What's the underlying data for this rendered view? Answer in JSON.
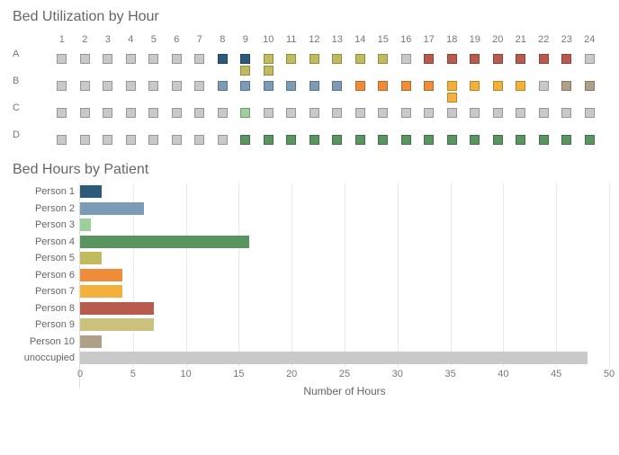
{
  "titles": {
    "heat": "Bed Utilization by Hour",
    "bars": "Bed Hours by Patient",
    "xlabel": "Number of Hours"
  },
  "colors": {
    "unoccupied": "#c9c9c9",
    "p1": "#2e5a7a",
    "p2": "#7c9bb6",
    "p3": "#9bcf9b",
    "p4": "#5a9460",
    "p5": "#c0bb5c",
    "p6": "#ef8c3a",
    "p7": "#f3b13c",
    "p8": "#b85a4c",
    "p9": "#cbc07e",
    "p10": "#b0a088"
  },
  "chart_data": [
    {
      "type": "heatmap",
      "title": "Bed Utilization by Hour",
      "x": [
        1,
        2,
        3,
        4,
        5,
        6,
        7,
        8,
        9,
        10,
        11,
        12,
        13,
        14,
        15,
        16,
        17,
        18,
        19,
        20,
        21,
        22,
        23,
        24
      ],
      "y": [
        "A",
        "B",
        "C",
        "D"
      ],
      "cells": {
        "A": [
          [
            "unoccupied"
          ],
          [
            "unoccupied"
          ],
          [
            "unoccupied"
          ],
          [
            "unoccupied"
          ],
          [
            "unoccupied"
          ],
          [
            "unoccupied"
          ],
          [
            "unoccupied"
          ],
          [
            "p1"
          ],
          [
            "p1",
            "p5"
          ],
          [
            "p5",
            "p5"
          ],
          [
            "p5"
          ],
          [
            "p5"
          ],
          [
            "p5"
          ],
          [
            "p5"
          ],
          [
            "p5"
          ],
          [
            "unoccupied"
          ],
          [
            "p8"
          ],
          [
            "p8"
          ],
          [
            "p8"
          ],
          [
            "p8"
          ],
          [
            "p8"
          ],
          [
            "p8"
          ],
          [
            "p8"
          ],
          [
            "unoccupied"
          ]
        ],
        "B": [
          [
            "unoccupied"
          ],
          [
            "unoccupied"
          ],
          [
            "unoccupied"
          ],
          [
            "unoccupied"
          ],
          [
            "unoccupied"
          ],
          [
            "unoccupied"
          ],
          [
            "unoccupied"
          ],
          [
            "p2"
          ],
          [
            "p2"
          ],
          [
            "p2"
          ],
          [
            "p2"
          ],
          [
            "p2"
          ],
          [
            "p2"
          ],
          [
            "p6"
          ],
          [
            "p6"
          ],
          [
            "p6"
          ],
          [
            "p6"
          ],
          [
            "p7",
            "p7"
          ],
          [
            "p7"
          ],
          [
            "p7"
          ],
          [
            "p7"
          ],
          [
            "unoccupied"
          ],
          [
            "p10"
          ],
          [
            "p10"
          ]
        ],
        "C": [
          [
            "unoccupied"
          ],
          [
            "unoccupied"
          ],
          [
            "unoccupied"
          ],
          [
            "unoccupied"
          ],
          [
            "unoccupied"
          ],
          [
            "unoccupied"
          ],
          [
            "unoccupied"
          ],
          [
            "unoccupied"
          ],
          [
            "p3"
          ],
          [
            "unoccupied"
          ],
          [
            "unoccupied"
          ],
          [
            "unoccupied"
          ],
          [
            "unoccupied"
          ],
          [
            "unoccupied"
          ],
          [
            "unoccupied"
          ],
          [
            "unoccupied"
          ],
          [
            "unoccupied"
          ],
          [
            "unoccupied"
          ],
          [
            "unoccupied"
          ],
          [
            "unoccupied"
          ],
          [
            "unoccupied"
          ],
          [
            "unoccupied"
          ],
          [
            "unoccupied"
          ],
          [
            "unoccupied"
          ]
        ],
        "D": [
          [
            "unoccupied"
          ],
          [
            "unoccupied"
          ],
          [
            "unoccupied"
          ],
          [
            "unoccupied"
          ],
          [
            "unoccupied"
          ],
          [
            "unoccupied"
          ],
          [
            "unoccupied"
          ],
          [
            "unoccupied"
          ],
          [
            "p4"
          ],
          [
            "p4"
          ],
          [
            "p4"
          ],
          [
            "p4"
          ],
          [
            "p4"
          ],
          [
            "p4"
          ],
          [
            "p4"
          ],
          [
            "p4"
          ],
          [
            "p4"
          ],
          [
            "p4"
          ],
          [
            "p4"
          ],
          [
            "p4"
          ],
          [
            "p4"
          ],
          [
            "p4"
          ],
          [
            "p4"
          ],
          [
            "p4"
          ]
        ]
      }
    },
    {
      "type": "bar",
      "title": "Bed Hours by Patient",
      "xlabel": "Number of Hours",
      "xlim": [
        0,
        50
      ],
      "xticks": [
        0,
        5,
        10,
        15,
        20,
        25,
        30,
        35,
        40,
        45,
        50
      ],
      "series": [
        {
          "name": "Person 1",
          "value": 2,
          "color": "p1"
        },
        {
          "name": "Person 2",
          "value": 6,
          "color": "p2"
        },
        {
          "name": "Person 3",
          "value": 1,
          "color": "p3"
        },
        {
          "name": "Person 4",
          "value": 16,
          "color": "p4"
        },
        {
          "name": "Person 5",
          "value": 2,
          "color": "p5"
        },
        {
          "name": "Person 6",
          "value": 4,
          "color": "p6"
        },
        {
          "name": "Person 7",
          "value": 4,
          "color": "p7"
        },
        {
          "name": "Person 8",
          "value": 7,
          "color": "p8"
        },
        {
          "name": "Person 9",
          "value": 7,
          "color": "p9"
        },
        {
          "name": "Person 10",
          "value": 2,
          "color": "p10"
        },
        {
          "name": "unoccupied",
          "value": 48,
          "color": "unoccupied"
        }
      ]
    }
  ]
}
